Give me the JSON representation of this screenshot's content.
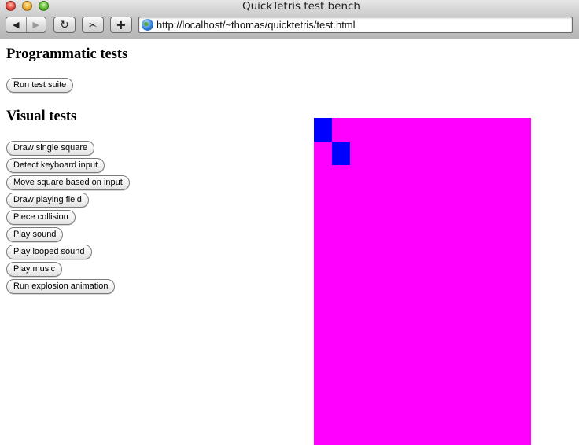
{
  "window": {
    "title": "QuickTetris test bench",
    "url": "http://localhost/~thomas/quicktetris/test.html"
  },
  "toolbar": {
    "back_glyph": "◀",
    "forward_glyph": "▶",
    "reload_glyph": "↻",
    "snapback_glyph": "✂",
    "add_glyph": "+",
    "icons": [
      "back-icon",
      "forward-icon",
      "reload-icon",
      "snapback-icon",
      "add-bookmark-icon",
      "globe-icon"
    ]
  },
  "sections": {
    "programmatic": {
      "heading": "Programmatic tests",
      "buttons": [
        "Run test suite"
      ]
    },
    "visual": {
      "heading": "Visual tests",
      "buttons": [
        "Draw single square",
        "Detect keyboard input",
        "Move square based on input",
        "Draw playing field",
        "Piece collision",
        "Play sound",
        "Play looped sound",
        "Play music",
        "Run explosion animation"
      ]
    }
  },
  "playfield": {
    "background_color": "#ff00ff",
    "square_color": "#0000ff",
    "squares": [
      {
        "col": 0,
        "row": 0
      },
      {
        "col": 1,
        "row": 1
      }
    ]
  }
}
